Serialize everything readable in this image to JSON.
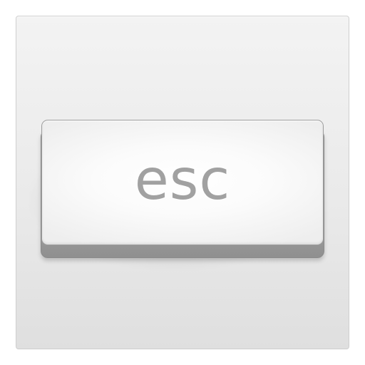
{
  "key": {
    "label": "esc",
    "icon": "escape-key-icon"
  },
  "colors": {
    "tile_background": "#eaeaea",
    "key_face": "#fbfbfb",
    "key_side": "#a9a9a9",
    "label_color": "#a1a1a1"
  }
}
